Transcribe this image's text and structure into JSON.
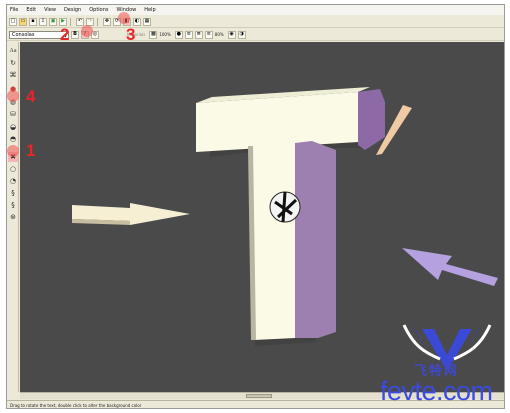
{
  "menu": [
    "File",
    "Edit",
    "View",
    "Design",
    "Options",
    "Window",
    "Help"
  ],
  "toolbar": {
    "font_value": "Consolas",
    "texture_label": "Materials",
    "zoom_value": "100%",
    "depth_value": "80%",
    "icons_row1": [
      "new-document-icon",
      "open-folder-icon",
      "save-icon",
      "export-icon",
      "render-icon",
      "play-icon",
      "undo-icon",
      "redo-icon",
      "move-icon",
      "rotate-icon",
      "bevel-icon",
      "color-icon",
      "light-icon"
    ],
    "icons_row2": [
      "bold-icon",
      "italic-icon",
      "align-left-icon",
      "align-center-icon",
      "align-right-icon"
    ]
  },
  "left_toolbar": [
    "Aa",
    "rotate-tool-icon",
    "shape-tool-icon",
    "sphere-icon",
    "color-ball-icon",
    "paint-bucket-icon",
    "lighting-icon",
    "texture-icon",
    "bevel-tool-icon",
    "clear-icon",
    "gradient-icon",
    "twist-icon",
    "curve-icon",
    "scroll-icon"
  ],
  "annotations": [
    "2",
    "3",
    "4",
    "1"
  ],
  "status_text": "Drag to rotate the text, double click to alter the background color",
  "scene": {
    "letter": "T",
    "background_color": "#4a4a4a",
    "front_face_color": "#fbfae6",
    "side_face_color": "#9d7fb0"
  },
  "watermark": {
    "chinese_name": "飞特网",
    "site": "fevte.com"
  }
}
